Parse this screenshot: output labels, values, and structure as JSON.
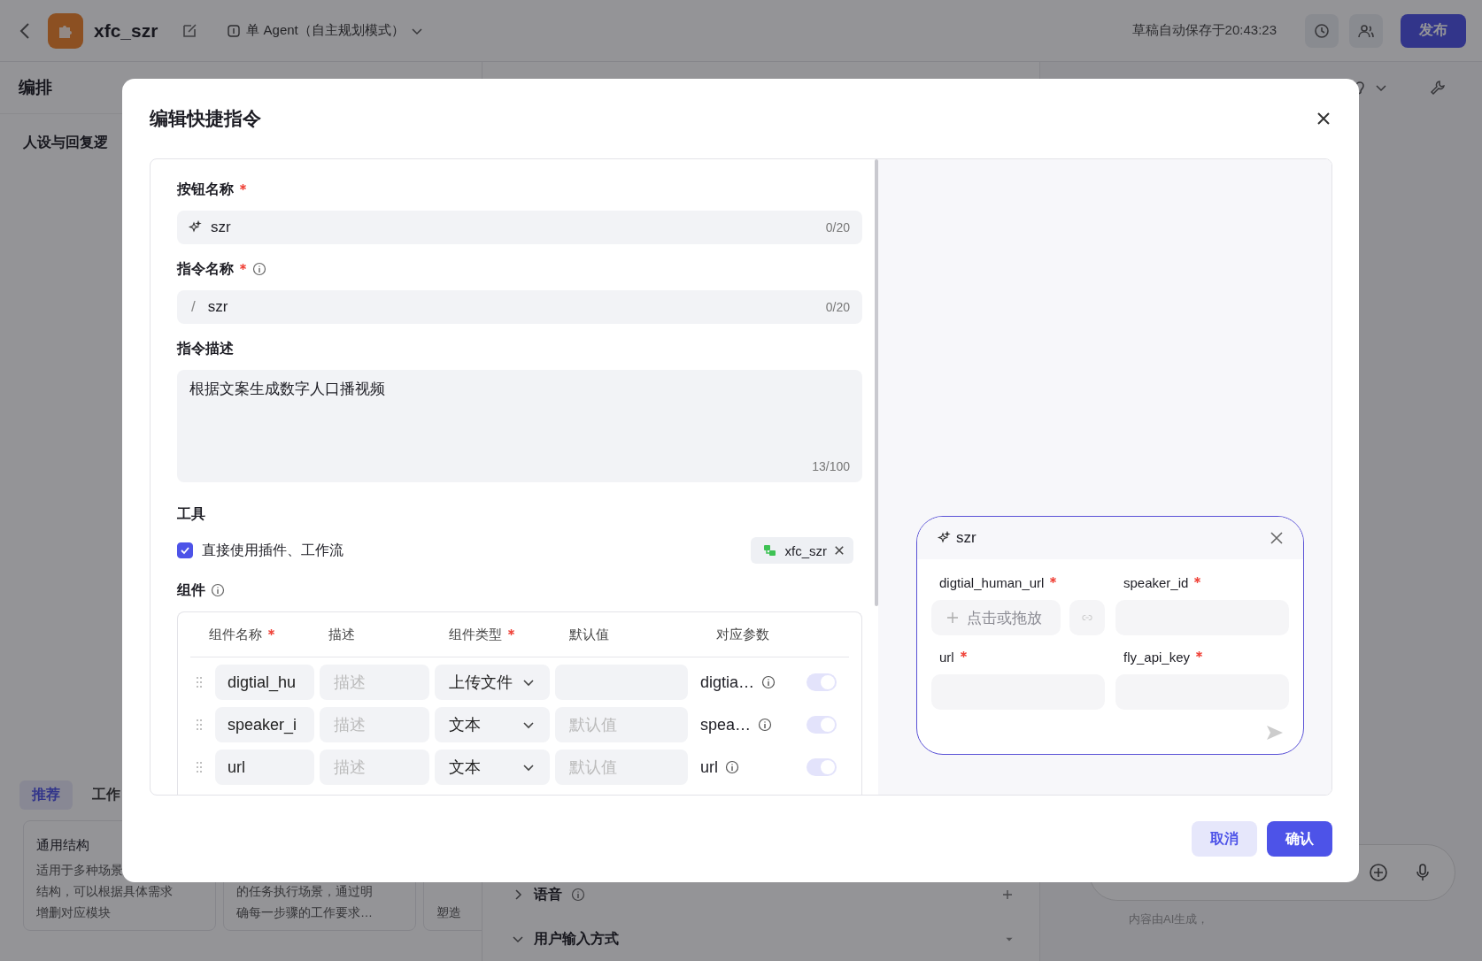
{
  "topbar": {
    "app_name": "xfc_szr",
    "mode": "单 Agent（自主规划模式）",
    "autosave": "草稿自动保存于20:43:23",
    "publish": "发布"
  },
  "editor": {
    "title": "编排",
    "persona": "人设与回复逻",
    "tabs": [
      {
        "label": "推荐",
        "selected": true
      },
      {
        "label": "工作",
        "selected": false
      }
    ],
    "cards": [
      {
        "title": "通用结构",
        "lines": [
          "适用于多种场景",
          "结构，可以根据具体需求",
          "增删对应模块"
        ]
      },
      {
        "lines": [
          "的任务执行场景，通过明",
          "确每一步骤的工作要求…"
        ]
      },
      {
        "lines": [
          "塑造"
        ]
      }
    ]
  },
  "settings": [
    {
      "label": "语音",
      "expanded": false,
      "info": true
    },
    {
      "label": "用户输入方式",
      "expanded": true
    }
  ],
  "chat": {
    "disclaimer": "内容由AI生成，"
  },
  "modal": {
    "title": "编辑快捷指令",
    "button_name": {
      "label": "按钮名称",
      "required": true,
      "value": "szr",
      "count": "0/20"
    },
    "command_name": {
      "label": "指令名称",
      "required": true,
      "info": true,
      "prefix": "/",
      "value": "szr",
      "count": "0/20"
    },
    "description": {
      "label": "指令描述",
      "value": "根据文案生成数字人口播视频",
      "count": "13/100"
    },
    "tools": {
      "label": "工具",
      "direct_use": {
        "label": "直接使用插件、工作流",
        "checked": true
      },
      "chip": "xfc_szr"
    },
    "components": {
      "label": "组件",
      "info": true,
      "columns": [
        {
          "label": "组件名称",
          "required": true
        },
        {
          "label": "描述",
          "required": false
        },
        {
          "label": "组件类型",
          "required": true
        },
        {
          "label": "默认值",
          "required": false
        },
        {
          "label": "对应参数",
          "required": false
        }
      ],
      "rows": [
        {
          "name": "digtial_hu",
          "description_placeholder": "描述",
          "type": "上传文件",
          "param": "digtia…",
          "on": true
        },
        {
          "name": "speaker_i",
          "description_placeholder": "描述",
          "type": "文本",
          "default_placeholder": "默认值",
          "param": "spea…",
          "on": true
        },
        {
          "name": "url",
          "description_placeholder": "描述",
          "type": "文本",
          "default_placeholder": "默认值",
          "param": "url",
          "on": true
        }
      ]
    },
    "preview": {
      "title": "szr",
      "params": [
        {
          "label": "digtial_human_url",
          "required": true,
          "kind": "upload",
          "placeholder": "点击或拖放"
        },
        {
          "label": "speaker_id",
          "required": true,
          "kind": "text"
        },
        {
          "label": "url",
          "required": true,
          "kind": "text"
        },
        {
          "label": "fly_api_key",
          "required": true,
          "kind": "text"
        }
      ]
    },
    "buttons": [
      {
        "label": "取消",
        "kind": "secondary"
      },
      {
        "label": "确认",
        "kind": "primary"
      }
    ]
  }
}
